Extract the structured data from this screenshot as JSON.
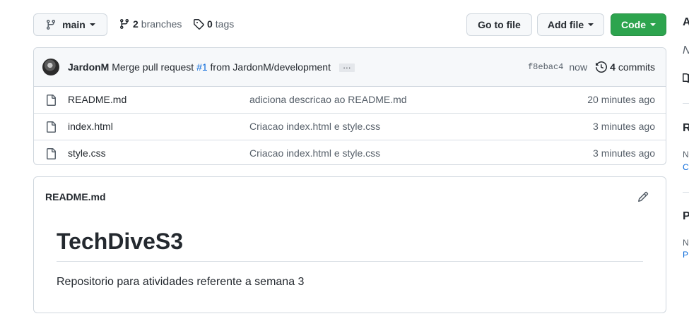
{
  "toolbar": {
    "branch_label": "main",
    "branches_count": "2",
    "branches_label": "branches",
    "tags_count": "0",
    "tags_label": "tags",
    "go_to_file": "Go to file",
    "add_file": "Add file",
    "code": "Code"
  },
  "commit": {
    "author": "JardonM",
    "message_prefix": "Merge pull request",
    "pr_number": "#1",
    "message_suffix": "from JardonM/development",
    "ellipsis": "…",
    "sha": "f8ebac4",
    "time": "now",
    "commit_count": "4",
    "commits_label": "commits"
  },
  "files": [
    {
      "name": "README.md",
      "message": "adiciona descricao ao README.md",
      "age": "20 minutes ago"
    },
    {
      "name": "index.html",
      "message": "Criacao index.html e style.css",
      "age": "3 minutes ago"
    },
    {
      "name": "style.css",
      "message": "Criacao index.html e style.css",
      "age": "3 minutes ago"
    }
  ],
  "readme": {
    "file_label": "README.md",
    "heading": "TechDiveS3",
    "body": "Repositorio para atividades referente a semana 3"
  },
  "sidebar": {
    "about_initial": "A",
    "desc_initial": "N",
    "releases_initial": "R",
    "releases_note_initial": "N",
    "releases_link_initial": "C",
    "packages_initial": "P",
    "packages_note_initial": "N",
    "packages_link_initial": "P"
  },
  "colors": {
    "code_button": "#2da44e",
    "link": "#0969da",
    "border": "#d0d7de"
  }
}
